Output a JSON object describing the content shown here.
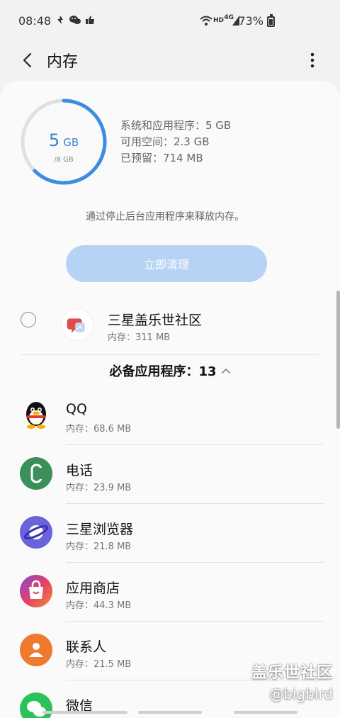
{
  "status_bar": {
    "time": "08:48",
    "left_icons": [
      "notification-icon",
      "wechat-icon",
      "thumbs-up-icon"
    ],
    "hd_label": "HD",
    "net_label": "4G",
    "battery_percent": "73%"
  },
  "app_bar": {
    "title": "内存"
  },
  "memory": {
    "used_value": "5",
    "used_unit": "GB",
    "total": "/8 GB",
    "used_fraction": 0.625,
    "stats": [
      "系统和应用程序：5 GB",
      "可用空间：2.3 GB",
      "已预留：714 MB"
    ],
    "ring_color": "#3a8de0"
  },
  "hint_text": "通过停止后台应用程序来释放内存。",
  "clean_button": "立即清理",
  "selectable_app": {
    "name": "三星盖乐世社区",
    "memory": "内存：311 MB",
    "selected": false
  },
  "section": {
    "label": "必备应用程序：13"
  },
  "apps": [
    {
      "name": "QQ",
      "memory": "内存：68.6 MB",
      "icon": "qq-penguin-icon"
    },
    {
      "name": "电话",
      "memory": "内存：23.9 MB",
      "icon": "phone-icon",
      "color": "#3a8f5a"
    },
    {
      "name": "三星浏览器",
      "memory": "内存：21.8 MB",
      "icon": "internet-planet-icon",
      "color": "#6b63d9"
    },
    {
      "name": "应用商店",
      "memory": "内存：44.3 MB",
      "icon": "shopping-bag-icon",
      "color": "#e4406a"
    },
    {
      "name": "联系人",
      "memory": "内存：21.5 MB",
      "icon": "contact-person-icon",
      "color": "#ee7a2e"
    },
    {
      "name": "微信",
      "memory": "",
      "icon": "wechat-icon",
      "color": "#2cc25a"
    }
  ],
  "watermark": {
    "line1": "盖乐世社区",
    "line2": "@bigbird"
  }
}
